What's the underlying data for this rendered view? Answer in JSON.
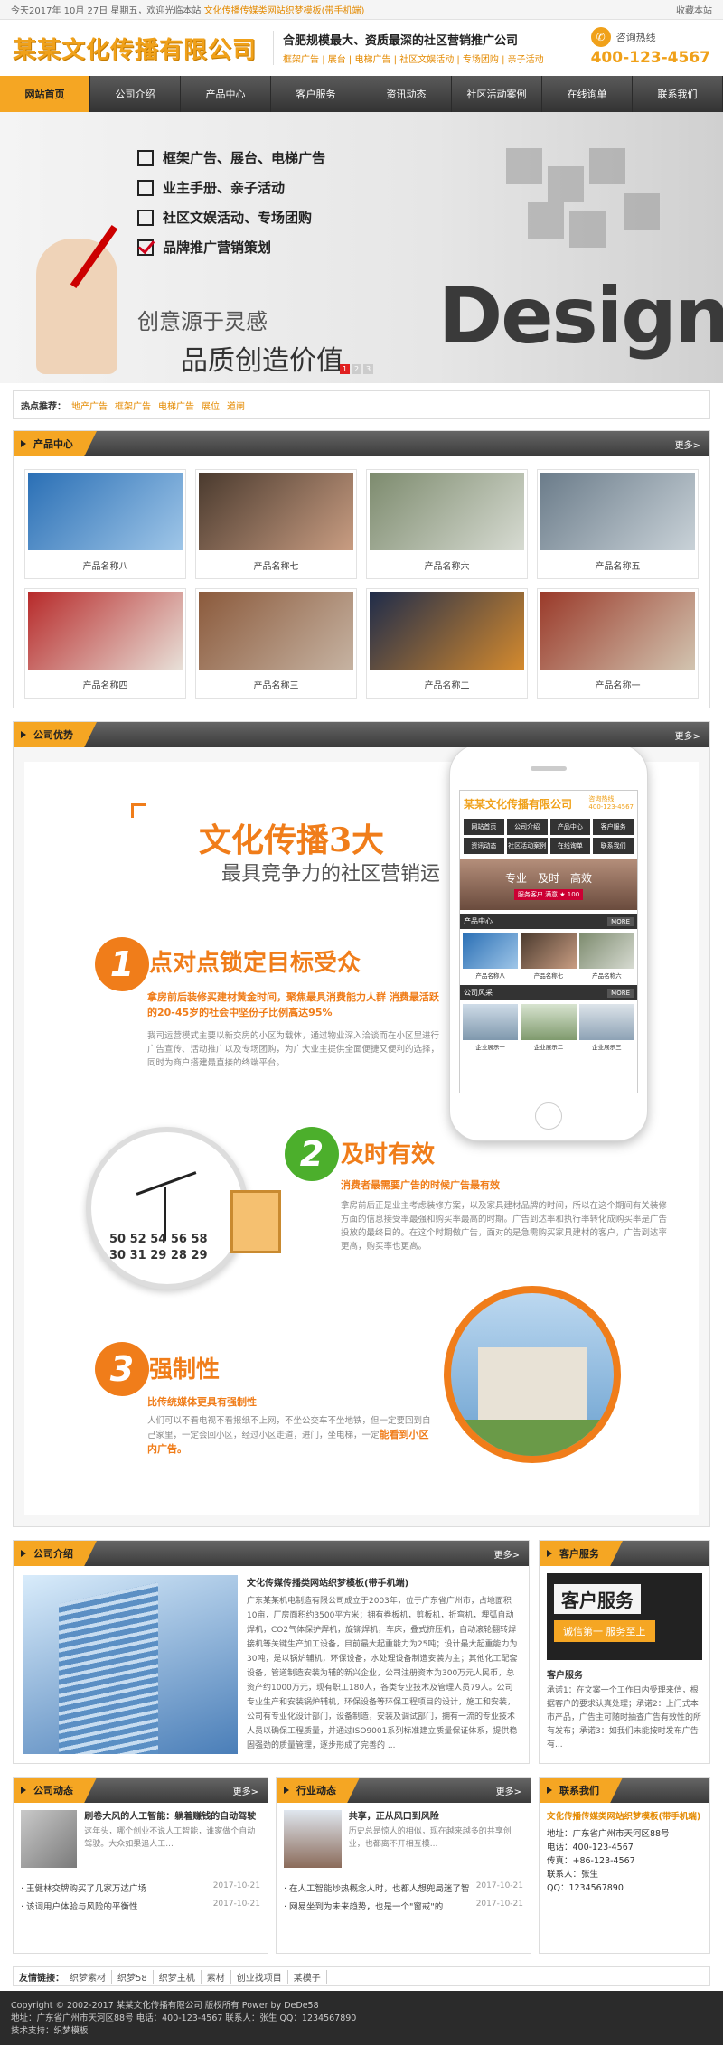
{
  "topbar": {
    "date": "今天2017年 10月 27日 星期五，欢迎光临本站",
    "site_name": "文化传播传媒类网站织梦模板(带手机端)",
    "right": "收藏本站"
  },
  "header": {
    "logo": "某某文化传播有限公司",
    "slogan_main": "合肥规模最大、资质最深的社区营销推广公司",
    "slogan_sub": "框架广告 | 展台 | 电梯广告 | 社区文娱活动 | 专场团购 | 亲子活动",
    "hotline_label": "咨询热线",
    "hotline": "400-123-4567"
  },
  "nav": [
    "网站首页",
    "公司介绍",
    "产品中心",
    "客户服务",
    "资讯动态",
    "社区活动案例",
    "在线询单",
    "联系我们"
  ],
  "banner": {
    "items": [
      "框架广告、展台、电梯广告",
      "业主手册、亲子活动",
      "社区文娱活动、专场团购",
      "品牌推广营销策划"
    ],
    "tagline1": "创意源于灵感",
    "tagline2": "品质创造价值",
    "design_word": "Design",
    "slides": [
      "1",
      "2",
      "3"
    ]
  },
  "hotwords": {
    "label": "热点推荐：",
    "items": [
      "地产广告",
      "框架广告",
      "电梯广告",
      "展位",
      "道闸"
    ]
  },
  "products": {
    "title": "产品中心",
    "more": "更多>",
    "items": [
      {
        "name": "产品名称八",
        "c1": "#2a6fb5",
        "c2": "#9fc6e8"
      },
      {
        "name": "产品名称七",
        "c1": "#4a3a2e",
        "c2": "#c99d82"
      },
      {
        "name": "产品名称六",
        "c1": "#7d8b6e",
        "c2": "#d7dbd2"
      },
      {
        "name": "产品名称五",
        "c1": "#6b7c8a",
        "c2": "#c9d2d8"
      },
      {
        "name": "产品名称四",
        "c1": "#b72a2a",
        "c2": "#e8e0d8"
      },
      {
        "name": "产品名称三",
        "c1": "#8b5a3c",
        "c2": "#c6b3a2"
      },
      {
        "name": "产品名称二",
        "c1": "#1f2c4a",
        "c2": "#d48a2e"
      },
      {
        "name": "产品名称一",
        "c1": "#9a3a2a",
        "c2": "#d2c4b0"
      }
    ]
  },
  "advantage": {
    "title": "公司优势",
    "more": "更多>",
    "h1": "文化传播3大",
    "h2": "最具竞争力的社区营销运",
    "p1": {
      "num": "1",
      "title": "点对点锁定目标受众",
      "sub": "拿房前后装修买建材黄金时间，聚焦最具消费能力人群 消费最活跃的20-45岁的社会中坚份子比例高达95%",
      "text": "我司运营模式主要以新交房的小区为载体，通过物业深入洽谈而在小区里进行广告宣传、活动推广以及专场团购，为广大业主提供全面便捷又便利的选择，同时为商户搭建最直接的终端平台。"
    },
    "p2": {
      "num": "2",
      "title": "及时有效",
      "sub": "消费者最需要广告的时候广告最有效",
      "text": "拿房前后正是业主考虑装修方案，以及家具建材品牌的时间，所以在这个期间有关装修方面的信息接受率最强和购买率最高的时期。广告到达率和执行率转化成购买率是广告投放的最终目的。在这个时期做广告，面对的是急需购买家具建材的客户，广告到达率更高，购买率也更高。"
    },
    "p3": {
      "num": "3",
      "title": "强制性",
      "sub": "比传统媒体更具有强制性",
      "text": "人们可以不看电视不看报纸不上网，不坐公交车不坐地铁，但一定要回到自己家里，一定会回小区，经过小区走道，进门，坐电梯，一定",
      "em": "能看到小区内广告。"
    },
    "clock_nums": [
      "50",
      "52",
      "54",
      "56",
      "58",
      "30",
      "31",
      "29",
      "28",
      "29"
    ],
    "phone": {
      "logo": "某某文化传播有限公司",
      "tel_label": "咨询热线",
      "tel": "400-123-4567",
      "nav": [
        "网站首页",
        "公司介绍",
        "产品中心",
        "客户服务",
        "资讯动态",
        "社区活动案例",
        "在线询单",
        "联系我们"
      ],
      "banner_text": "专业　及时　高效",
      "banner_sub": "服务客户 满意 ★ 100",
      "sec1": "产品中心",
      "sec1_items": [
        "产品名称八",
        "产品名称七",
        "产品名称六"
      ],
      "sec2": "公司风采",
      "sec2_items": [
        "企业展示一",
        "企业展示二",
        "企业展示三"
      ],
      "more": "MORE"
    }
  },
  "about": {
    "title": "公司介绍",
    "more": "更多>",
    "heading": "文化传媒传播类网站织梦模板(带手机端)",
    "text": "广东某某机电制造有限公司成立于2003年，位于广东省广州市，占地面积10亩，厂房面积约3500平方米；拥有卷板机，剪板机，折弯机，埋弧自动焊机，CO2气体保护焊机，旋铆焊机，车床，叠式挤压机，自动滚轮翻转焊接机等关键生产加工设备，目前最大起重能力为25吨；设计最大起重能力为30吨，是以锅炉辅机，环保设备，水处理设备制造安装为主；其他化工配套设备，管道制造安装为辅的新兴企业，公司注册资本为300万元人民币，总资产约1000万元，现有职工180人，各类专业技术及管理人员79人。公司专业生产和安装锅炉辅机，环保设备等环保工程项目的设计，施工和安装，公司有专业化设计部门，设备制造，安装及调试部门，拥有一流的专业技术人员以确保工程质量，并通过ISO9001系列标准建立质量保证体系，提供稳固强劲的质量管理，逐步形成了完善的 ..."
  },
  "service": {
    "title": "客户服务",
    "img_text": "客户服务",
    "img_sub": "诚信第一 服务至上",
    "heading": "客户服务",
    "text": "承诺1：在文案一个工作日内受理来信，根据客户的要求认真处理；承诺2：上门式本市产品，广告主可随时抽查广告有效性的所有发布；承诺3：如我们未能按时发布广告有..."
  },
  "news1": {
    "title": "公司动态",
    "more": "更多>",
    "top_title": "刷卷大风的人工智能：躺着赚钱的自动驾驶",
    "top_text": "这年头，哪个创业不说人工智能，谁家做个自动驾驶。大众如果追人工...",
    "list": [
      {
        "t": "· 王健林交牌购买了几家万达广场",
        "d": "2017-10-21"
      },
      {
        "t": "· 该词用户体验与风险的平衡性",
        "d": "2017-10-21"
      }
    ]
  },
  "news2": {
    "title": "行业动态",
    "more": "更多>",
    "top_title": "共享，正从风口到风险",
    "top_text": "历史总是惊人的相似，现在越来越多的共享创业，也都离不开相互模...",
    "list": [
      {
        "t": "· 在人工智能炒热概念人时，也都人想兜局迷了智",
        "d": "2017-10-21"
      },
      {
        "t": "· 网易坐到为未来趋势，也是一个\"窗戒\"的",
        "d": "2017-10-21"
      }
    ]
  },
  "contact": {
    "title": "联系我们",
    "heading": "文化传播传媒类网站织梦模板(带手机端)",
    "lines": [
      "地址：广东省广州市天河区88号",
      "电话：400-123-4567",
      "传真：+86-123-4567",
      "联系人：张生",
      "QQ：1234567890"
    ]
  },
  "links": {
    "label": "友情链接：",
    "items": [
      "织梦素材",
      "织梦58",
      "织梦主机",
      "素材",
      "创业找项目",
      "某模子"
    ]
  },
  "footer": {
    "line1": "Copyright © 2002-2017 某某文化传播有限公司 版权所有 Power by DeDe58",
    "line2": "地址：广东省广州市天河区88号 电话：400-123-4567 联系人：张生 QQ：1234567890",
    "line3": "技术支持：织梦模板"
  },
  "colors": {
    "accent": "#f5a623",
    "orange": "#f07d1a",
    "green": "#4caf2c",
    "dark": "#333333"
  }
}
